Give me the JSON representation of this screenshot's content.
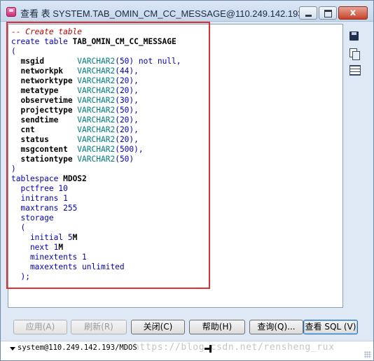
{
  "window": {
    "title": "查看 表 SYSTEM.TAB_OMIN_CM_CC_MESSAGE@110.249.142.193/...",
    "close_glyph": "x"
  },
  "code_lines": [
    [
      {
        "t": "-- Create table",
        "c": "comment"
      }
    ],
    [
      {
        "t": "create table ",
        "c": "kw"
      },
      {
        "t": "TAB_OMIN_CM_CC_MESSAGE",
        "c": "id"
      }
    ],
    [
      {
        "t": "(",
        "c": "kw"
      }
    ],
    [
      {
        "t": "  msgid       ",
        "c": "id"
      },
      {
        "t": "VARCHAR2",
        "c": "type"
      },
      {
        "t": "(",
        "c": "kw"
      },
      {
        "t": "50",
        "c": "num"
      },
      {
        "t": ") not null,",
        "c": "kw"
      }
    ],
    [
      {
        "t": "  networkpk   ",
        "c": "id"
      },
      {
        "t": "VARCHAR2",
        "c": "type"
      },
      {
        "t": "(",
        "c": "kw"
      },
      {
        "t": "44",
        "c": "num"
      },
      {
        "t": "),",
        "c": "kw"
      }
    ],
    [
      {
        "t": "  networktype ",
        "c": "id"
      },
      {
        "t": "VARCHAR2",
        "c": "type"
      },
      {
        "t": "(",
        "c": "kw"
      },
      {
        "t": "20",
        "c": "num"
      },
      {
        "t": "),",
        "c": "kw"
      }
    ],
    [
      {
        "t": "  metatype    ",
        "c": "id"
      },
      {
        "t": "VARCHAR2",
        "c": "type"
      },
      {
        "t": "(",
        "c": "kw"
      },
      {
        "t": "20",
        "c": "num"
      },
      {
        "t": "),",
        "c": "kw"
      }
    ],
    [
      {
        "t": "  observetime ",
        "c": "id"
      },
      {
        "t": "VARCHAR2",
        "c": "type"
      },
      {
        "t": "(",
        "c": "kw"
      },
      {
        "t": "30",
        "c": "num"
      },
      {
        "t": "),",
        "c": "kw"
      }
    ],
    [
      {
        "t": "  projecttype ",
        "c": "id"
      },
      {
        "t": "VARCHAR2",
        "c": "type"
      },
      {
        "t": "(",
        "c": "kw"
      },
      {
        "t": "50",
        "c": "num"
      },
      {
        "t": "),",
        "c": "kw"
      }
    ],
    [
      {
        "t": "  sendtime    ",
        "c": "id"
      },
      {
        "t": "VARCHAR2",
        "c": "type"
      },
      {
        "t": "(",
        "c": "kw"
      },
      {
        "t": "20",
        "c": "num"
      },
      {
        "t": "),",
        "c": "kw"
      }
    ],
    [
      {
        "t": "  cnt         ",
        "c": "id"
      },
      {
        "t": "VARCHAR2",
        "c": "type"
      },
      {
        "t": "(",
        "c": "kw"
      },
      {
        "t": "20",
        "c": "num"
      },
      {
        "t": "),",
        "c": "kw"
      }
    ],
    [
      {
        "t": "  status      ",
        "c": "id"
      },
      {
        "t": "VARCHAR2",
        "c": "type"
      },
      {
        "t": "(",
        "c": "kw"
      },
      {
        "t": "20",
        "c": "num"
      },
      {
        "t": "),",
        "c": "kw"
      }
    ],
    [
      {
        "t": "  msgcontent  ",
        "c": "id"
      },
      {
        "t": "VARCHAR2",
        "c": "type"
      },
      {
        "t": "(",
        "c": "kw"
      },
      {
        "t": "500",
        "c": "num"
      },
      {
        "t": "),",
        "c": "kw"
      }
    ],
    [
      {
        "t": "  stationtype ",
        "c": "id"
      },
      {
        "t": "VARCHAR2",
        "c": "type"
      },
      {
        "t": "(",
        "c": "kw"
      },
      {
        "t": "50",
        "c": "num"
      },
      {
        "t": ")",
        "c": "kw"
      }
    ],
    [
      {
        "t": ")",
        "c": "kw"
      }
    ],
    [
      {
        "t": "tablespace ",
        "c": "kw"
      },
      {
        "t": "MDOS2",
        "c": "id"
      }
    ],
    [
      {
        "t": "  pctfree ",
        "c": "kw"
      },
      {
        "t": "10",
        "c": "num"
      }
    ],
    [
      {
        "t": "  initrans ",
        "c": "kw"
      },
      {
        "t": "1",
        "c": "num"
      }
    ],
    [
      {
        "t": "  maxtrans ",
        "c": "kw"
      },
      {
        "t": "255",
        "c": "num"
      }
    ],
    [
      {
        "t": "  storage",
        "c": "kw"
      }
    ],
    [
      {
        "t": "  (",
        "c": "kw"
      }
    ],
    [
      {
        "t": "    initial ",
        "c": "kw"
      },
      {
        "t": "5",
        "c": "num"
      },
      {
        "t": "M",
        "c": "id"
      }
    ],
    [
      {
        "t": "    next ",
        "c": "kw"
      },
      {
        "t": "1",
        "c": "num"
      },
      {
        "t": "M",
        "c": "id"
      }
    ],
    [
      {
        "t": "    minextents ",
        "c": "kw"
      },
      {
        "t": "1",
        "c": "num"
      }
    ],
    [
      {
        "t": "    maxextents unlimited",
        "c": "kw"
      }
    ],
    [
      {
        "t": "  );",
        "c": "kw"
      }
    ]
  ],
  "buttons": {
    "apply": "应用(A)",
    "refresh": "刷新(R)",
    "close": "关闭(C)",
    "help": "帮助(H)",
    "query": "查询(Q)...",
    "view_sql": "查看 SQL (V)"
  },
  "status": {
    "connection": "system@110.249.142.193/MDOS",
    "watermark": "https://blog.csdn.net/rensheng_rux"
  },
  "icons": {
    "app": "table-view-icon",
    "save": "save-icon",
    "copy": "copy-icon",
    "grid": "grid-icon"
  }
}
